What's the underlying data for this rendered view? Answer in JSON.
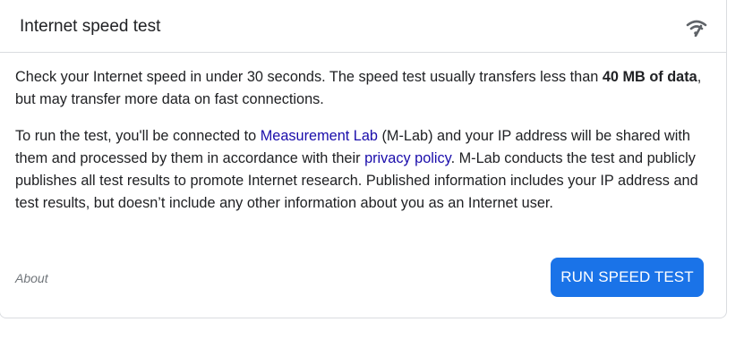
{
  "header": {
    "title": "Internet speed test",
    "icon": "wifi-signal-icon"
  },
  "body": {
    "p1_part1": "Check your Internet speed in under 30 seconds. The speed test usually transfers less than ",
    "p1_bold": "40 MB of data",
    "p1_part2": ", but may transfer more data on fast connections.",
    "p2_part1": "To run the test, you'll be connected to ",
    "p2_link1": "Measurement Lab",
    "p2_part2": " (M-Lab) and your IP address will be shared with them and processed by them in accordance with their ",
    "p2_link2": "privacy policy",
    "p2_part3": ". M-Lab conducts the test and publicly publishes all test results to promote Internet research. Published information includes your IP address and test results, but doesn’t include any other information about you as an Internet user."
  },
  "footer": {
    "about_label": "About",
    "run_button_label": "RUN SPEED TEST"
  },
  "colors": {
    "accent": "#1a73e8",
    "link": "#1a0dab",
    "muted": "#70757a",
    "border": "#dadce0"
  }
}
